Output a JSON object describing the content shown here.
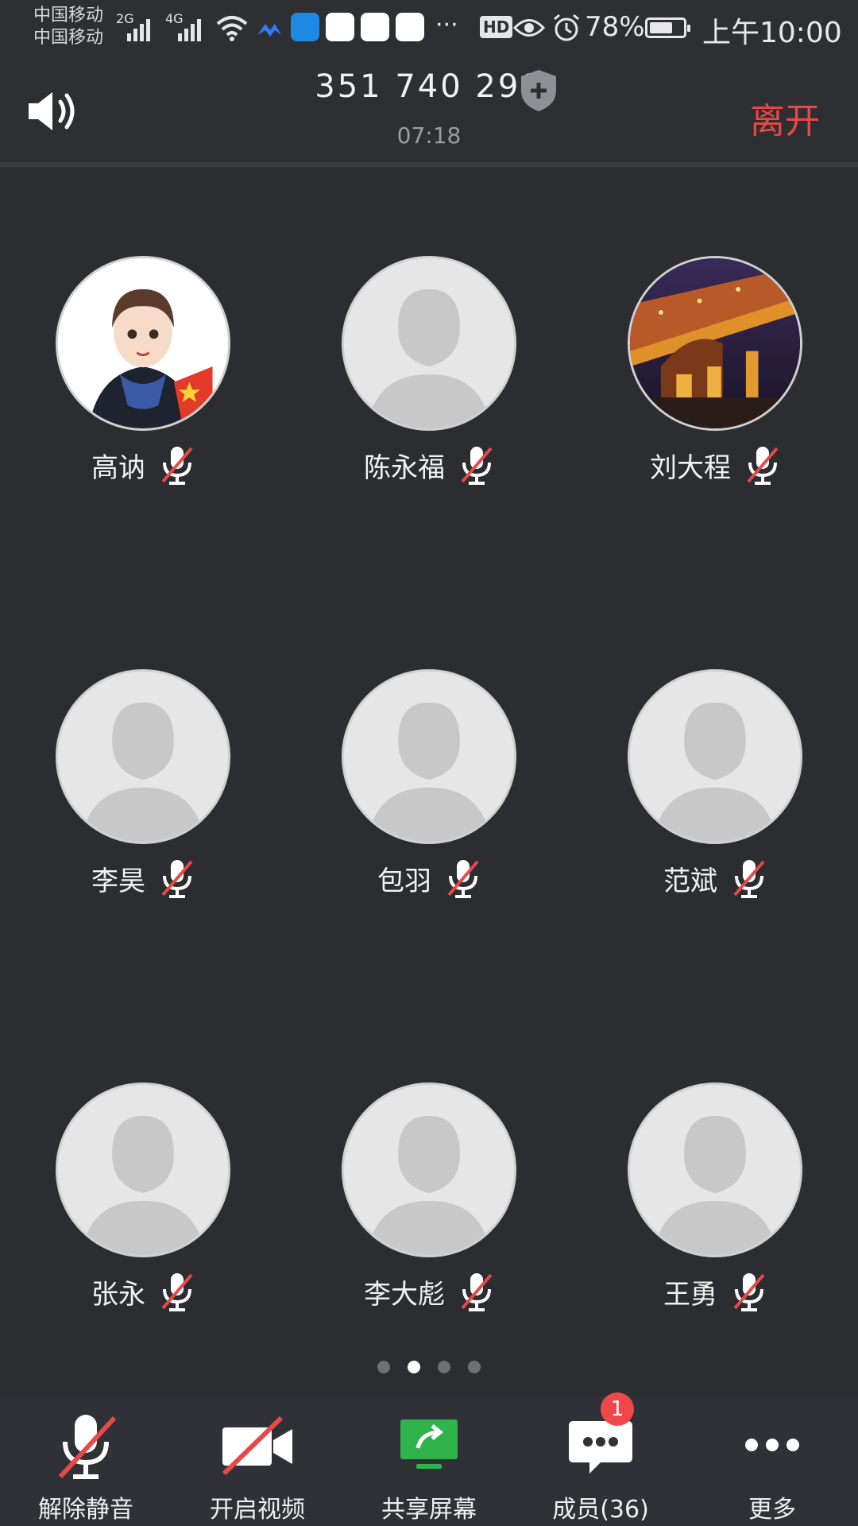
{
  "status_bar": {
    "carrier_1": "中国移动",
    "carrier_2": "中国移动",
    "net_1": "2G",
    "net_2": "4G",
    "hd": "HD",
    "battery": "78%",
    "time": "上午10:00",
    "more": "···"
  },
  "header": {
    "meeting_id": "351 740 298",
    "timer": "07:18",
    "leave": "离开"
  },
  "participants": [
    {
      "name": "高讷",
      "avatar": "custom-cartoon"
    },
    {
      "name": "陈永福",
      "avatar": "default"
    },
    {
      "name": "刘大程",
      "avatar": "bridge-photo"
    },
    {
      "name": "李昊",
      "avatar": "default"
    },
    {
      "name": "包羽",
      "avatar": "default"
    },
    {
      "name": "范斌",
      "avatar": "default"
    },
    {
      "name": "张永",
      "avatar": "default"
    },
    {
      "name": "李大彪",
      "avatar": "default"
    },
    {
      "name": "王勇",
      "avatar": "default"
    }
  ],
  "pagination": {
    "pages": 4,
    "current": 2
  },
  "toolbar": {
    "unmute": "解除静音",
    "video": "开启视频",
    "share": "共享屏幕",
    "members": "成员(36)",
    "members_badge": "1",
    "more": "更多"
  },
  "colors": {
    "background": "#2b2d31",
    "leave": "#e84848",
    "muted_slash": "#e84848",
    "share_green": "#2fb34a",
    "badge": "#f04848"
  }
}
